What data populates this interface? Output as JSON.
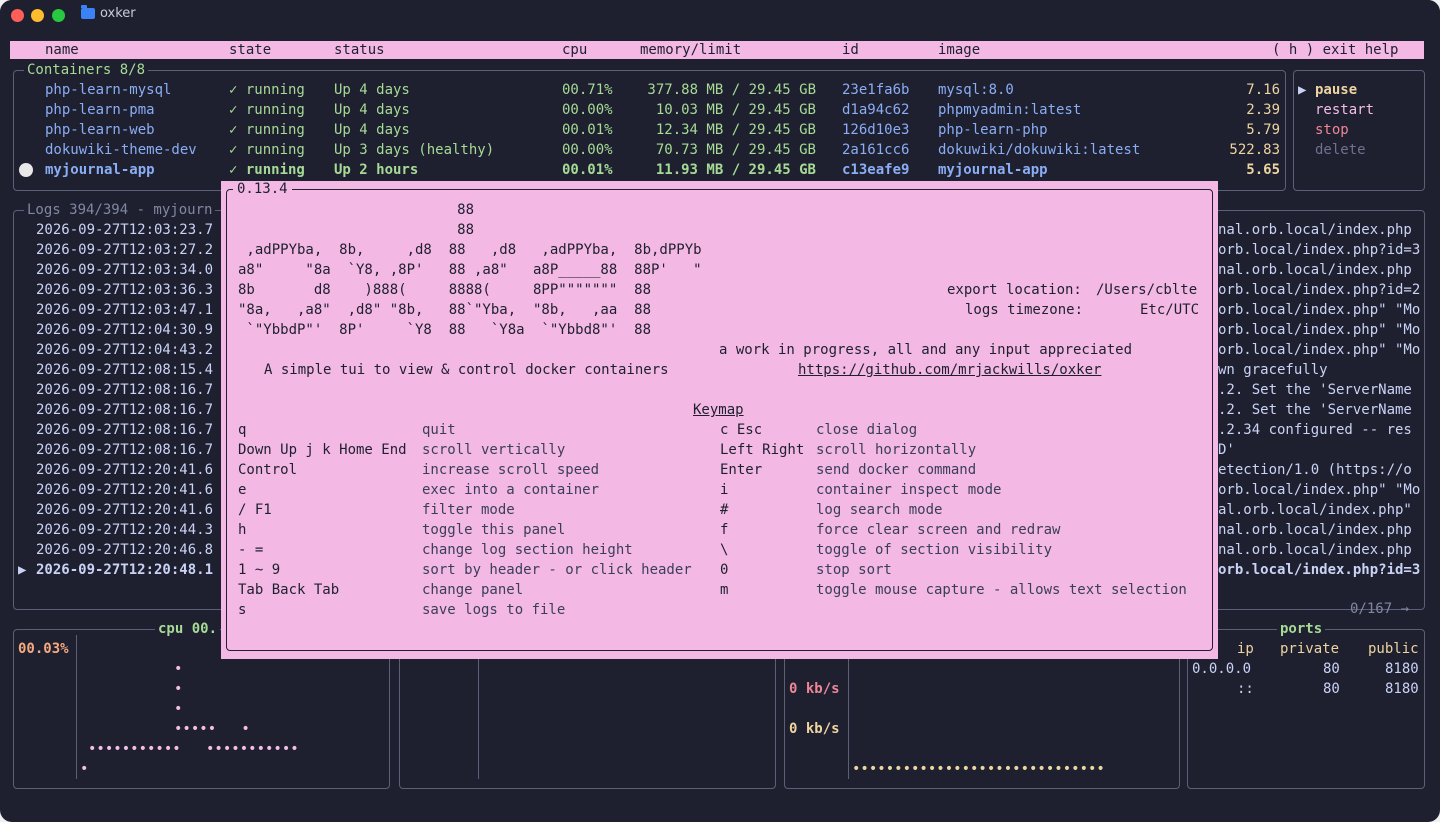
{
  "window": {
    "title": "oxker"
  },
  "header": {
    "columns": [
      "name",
      "state",
      "status",
      "cpu",
      "memory/limit",
      "id",
      "image"
    ],
    "help_hint": "( h ) exit help"
  },
  "containers": {
    "title": "Containers 8/8",
    "rows": [
      {
        "name": "php-learn-mysql",
        "state": "✓ running",
        "status": "Up 4 days",
        "cpu": "00.71%",
        "memory": "377.88 MB / 29.45 GB",
        "id": "23e1fa6b",
        "image": "mysql:8.0",
        "value": "7.16"
      },
      {
        "name": "php-learn-pma",
        "state": "✓ running",
        "status": "Up 4 days",
        "cpu": "00.00%",
        "memory": "10.03 MB / 29.45 GB",
        "id": "d1a94c62",
        "image": "phpmyadmin:latest",
        "value": "2.39"
      },
      {
        "name": "php-learn-web",
        "state": "✓ running",
        "status": "Up 4 days",
        "cpu": "00.01%",
        "memory": "12.34 MB / 29.45 GB",
        "id": "126d10e3",
        "image": "php-learn-php",
        "value": "5.79"
      },
      {
        "name": "dokuwiki-theme-dev",
        "state": "✓ running",
        "status": "Up 3 days (healthy)",
        "cpu": "00.00%",
        "memory": "70.73 MB / 29.45 GB",
        "id": "2a161cc6",
        "image": "dokuwiki/dokuwiki:latest",
        "value": "522.83"
      },
      {
        "name": "myjournal-app",
        "state": "✓ running",
        "status": "Up 2 hours",
        "cpu": "00.01%",
        "memory": "11.93 MB / 29.45 GB",
        "id": "c13eafe9",
        "image": "myjournal-app",
        "value": "5.65"
      }
    ]
  },
  "commands": {
    "selected_marker": "▶",
    "items": [
      "pause",
      "restart",
      "stop",
      "delete"
    ]
  },
  "logs": {
    "title": "Logs 394/394 - myjourn",
    "timestamps": [
      "2026-09-27T12:03:23.7",
      "2026-09-27T12:03:27.2",
      "2026-09-27T12:03:34.0",
      "2026-09-27T12:03:36.3",
      "2026-09-27T12:03:47.1",
      "2026-09-27T12:04:30.9",
      "2026-09-27T12:04:43.2",
      "2026-09-27T12:08:15.4",
      "2026-09-27T12:08:16.7",
      "2026-09-27T12:08:16.7",
      "2026-09-27T12:08:16.7",
      "2026-09-27T12:08:16.7",
      "2026-09-27T12:20:41.6",
      "2026-09-27T12:20:41.6",
      "2026-09-27T12:20:41.6",
      "2026-09-27T12:20:44.3",
      "2026-09-27T12:20:46.8",
      "2026-09-27T12:20:48.1"
    ],
    "tails": [
      "nal.orb.local/index.php",
      "orb.local/index.php?id=3",
      "nal.orb.local/index.php",
      "orb.local/index.php?id=2",
      "orb.local/index.php\" \"Mo",
      "orb.local/index.php\" \"Mo",
      "orb.local/index.php\" \"Mo",
      "wn gracefully",
      ".2. Set the 'ServerName",
      ".2. Set the 'ServerName",
      ".2.34 configured -- res",
      "D'",
      "etection/1.0 (https://o",
      "orb.local/index.php\" \"Mo",
      "al.orb.local/index.php\"",
      "nal.orb.local/index.php",
      "nal.orb.local/index.php",
      "orb.local/index.php?id=3"
    ],
    "selected_marker": "▶",
    "pager": "0/167 →"
  },
  "cpu_panel": {
    "title": "cpu 00.",
    "value": "00.03%"
  },
  "net_panel": {
    "rx": "0 kb/s",
    "tx": "0 kb/s"
  },
  "ports_panel": {
    "title": "ports",
    "headers": [
      "ip",
      "private",
      "public"
    ],
    "rows": [
      {
        "ip": "0.0.0.0",
        "private": "80",
        "public": "8180"
      },
      {
        "ip": "::",
        "private": "80",
        "public": "8180"
      }
    ]
  },
  "help": {
    "version": "0.13.4",
    "ascii_logo": [
      "                          88",
      "                          88",
      " ,adPPYba,  8b,     ,d8  88   ,d8   ,adPPYba,  8b,dPPYb",
      "a8\"     \"8a  `Y8, ,8P'   88 ,a8\"   a8P_____88  88P'   \"",
      "8b       d8    )888(     8888(     8PP\"\"\"\"\"\"\"  88",
      "\"8a,   ,a8\"  ,d8\" \"8b,   88`\"Yba,  \"8b,   ,aa  88",
      " `\"YbbdP\"'  8P'     `Y8  88   `Y8a  `\"Ybbd8\"'  88"
    ],
    "export_label": "export location:",
    "export_value": "/Users/cblte",
    "tz_label": "logs timezone:",
    "tz_value": "Etc/UTC",
    "tagline": "A simple tui to view & control docker containers",
    "wip": "a work in progress, all and any input appreciated",
    "url": "https://github.com/mrjackwills/oxker",
    "keymap_title": "Keymap",
    "keymap_left": [
      {
        "key": "q",
        "desc": "quit"
      },
      {
        "key": "Down Up j k Home End",
        "desc": "scroll vertically"
      },
      {
        "key": "Control",
        "desc": "increase scroll speed"
      },
      {
        "key": "e",
        "desc": "exec into a container"
      },
      {
        "key": "/ F1",
        "desc": "filter mode"
      },
      {
        "key": "h",
        "desc": "toggle this panel"
      },
      {
        "key": "- =",
        "desc": "change log section height"
      },
      {
        "key": "1 ~ 9",
        "desc": "sort by header - or click header"
      },
      {
        "key": "Tab Back Tab",
        "desc": "change panel"
      },
      {
        "key": "s",
        "desc": "save logs to file"
      }
    ],
    "keymap_right": [
      {
        "key": "c Esc",
        "desc": "close dialog"
      },
      {
        "key": "Left Right",
        "desc": "scroll horizontally"
      },
      {
        "key": "Enter",
        "desc": "send docker command"
      },
      {
        "key": "i",
        "desc": "container inspect mode"
      },
      {
        "key": "#",
        "desc": "log search mode"
      },
      {
        "key": "f",
        "desc": "force clear screen and redraw"
      },
      {
        "key": "\\",
        "desc": "toggle of section visibility"
      },
      {
        "key": "0",
        "desc": "stop sort"
      },
      {
        "key": "m",
        "desc": "toggle mouse capture - allows text selection"
      }
    ]
  }
}
